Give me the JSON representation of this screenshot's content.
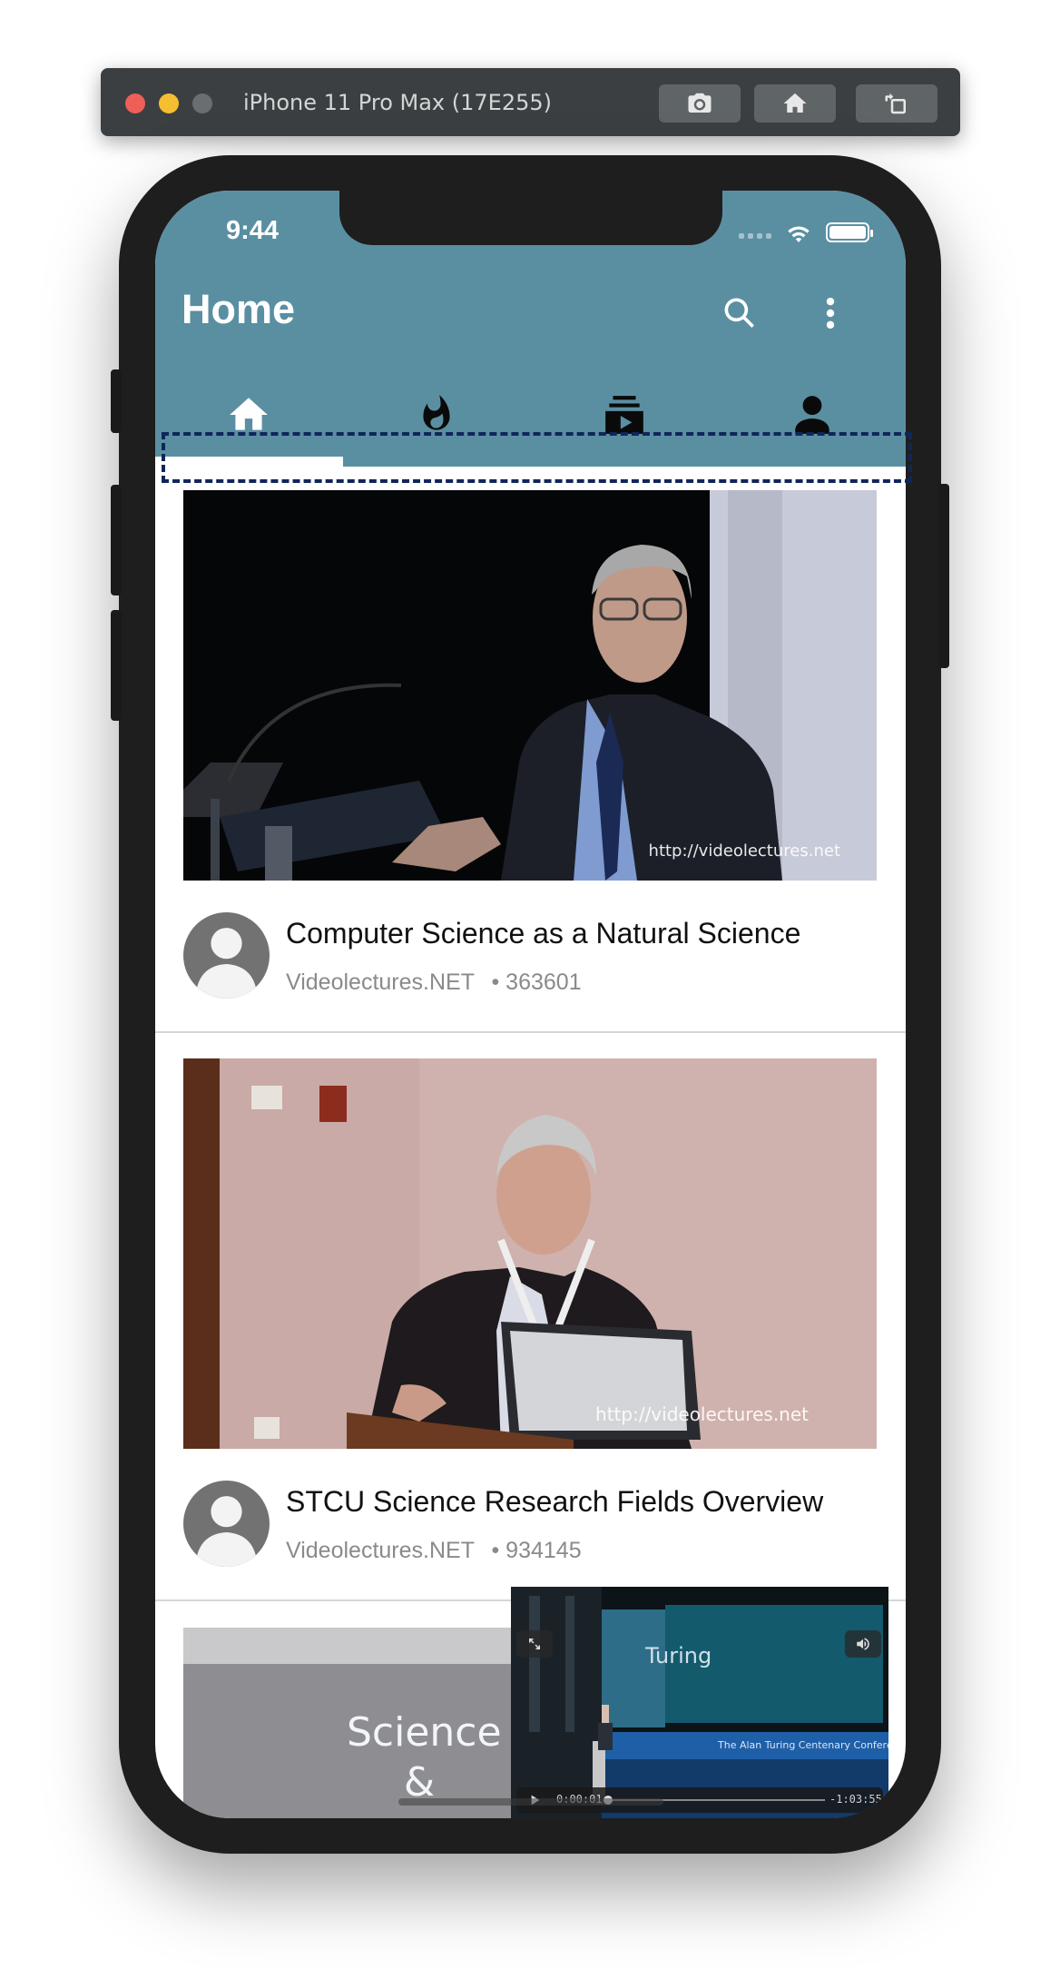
{
  "simulator": {
    "title": "iPhone 11 Pro Max (17E255)",
    "buttons": [
      "screenshot",
      "home",
      "rotate"
    ]
  },
  "status_bar": {
    "time": "9:44"
  },
  "appbar": {
    "title": "Home",
    "color": "#5a8fa2"
  },
  "tabs": [
    {
      "name": "home",
      "icon": "home-icon",
      "selected": true
    },
    {
      "name": "trending",
      "icon": "fire-icon",
      "selected": false
    },
    {
      "name": "subscriptions",
      "icon": "subscriptions-icon",
      "selected": false
    },
    {
      "name": "account",
      "icon": "person-icon",
      "selected": false
    }
  ],
  "feed": [
    {
      "title": "Computer Science as a Natural Science",
      "channel": "Videolectures.NET",
      "views": "• 363601",
      "watermark": "http://videolectures.net"
    },
    {
      "title": "STCU Science Research Fields Overview",
      "channel": "Videolectures.NET",
      "views": "• 934145",
      "watermark": "http://videolectures.net"
    },
    {
      "thumb_text_line1": "Science",
      "thumb_text_line2": "&"
    }
  ],
  "mini_player": {
    "current_time": "0:00:01",
    "remaining_time": "-1:03:55",
    "slide_text": "Turing",
    "banner_text": "The Alan Turing Centenary Conference"
  }
}
